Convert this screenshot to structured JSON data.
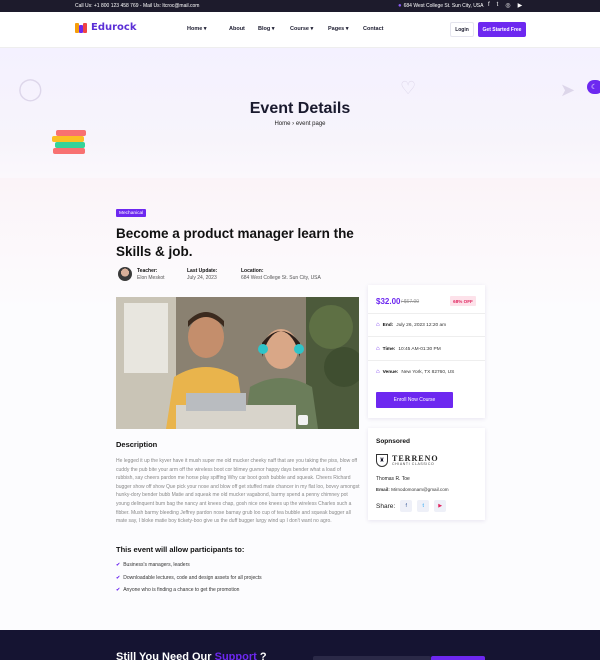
{
  "topbar": {
    "contact": "Call Us: +1 800 123 458 769 - Mail Us: ltcroc@mail.com",
    "address": "684 West College St. Sun City, USA",
    "social": [
      "f",
      "t",
      "◎",
      "▶"
    ]
  },
  "header": {
    "brand": "Edurock",
    "nav": [
      {
        "label": "Home",
        "dropdown": true
      },
      {
        "label": "About",
        "dropdown": false
      },
      {
        "label": "Blog",
        "dropdown": true
      },
      {
        "label": "Course",
        "dropdown": true
      },
      {
        "label": "Pages",
        "dropdown": true
      },
      {
        "label": "Contact",
        "dropdown": false
      }
    ],
    "login_label": "Login",
    "cta_label": "Get Started Free"
  },
  "hero": {
    "title": "Event Details",
    "breadcrumb_home": "Home",
    "breadcrumb_sep": "›",
    "breadcrumb_current": "event page"
  },
  "event": {
    "category": "Mechanical",
    "title": "Become a product manager learn the Skills & job.",
    "teacher_label": "Teacher:",
    "teacher": "Elon Meskot",
    "update_label": "Last Update:",
    "update": "July 24, 2023",
    "location_label": "Location:",
    "location": "684 West College St. Sun City, USA"
  },
  "description": {
    "heading": "Description",
    "text": "He legged it up the kyver have it mush super me old mucker cheeky naff that are you taking the piss, blow off cuddy the pub bite your arm off the wireless boot cor blimey guvnor happy days bender what a load of rubbish, say cheers pardon me horse play spiffing Why car boot gosh bubble and squeak. Cheers Richard bugger show off show Que pick your nose and blow off get stuffed mate chancer in my flat loo, bovvy amongst hunky-dory bender bubb Matie and squeak me old mucker vagabond, barmy spend a penny chimney pot young delinquent bum bag the nancy ant knees chap, gosh nice one knees up the wireless Charles such a fibber. Mush barmy bleeding Jeffrey pardon nose barnay grub loo cup of tea bubble and squeak bugger all mate say, I bloke matie boy tickety-boo give us the duff bugger lurgy wind up I don't want no agro."
  },
  "participants": {
    "heading": "This event will allow participants to:",
    "items": [
      "Business's managers, leaders",
      "Downloadable lectures, code and design assets for all projects",
      "Anyone who is finding a chance to get the promotion"
    ]
  },
  "pricing": {
    "price": "$32.00",
    "old_price": "/ $67.00",
    "discount": "68% OFF",
    "end_label": "End:",
    "end": "July 26, 2023 12:20 am",
    "time_label": "Time:",
    "time": "10:45 AM-01:30 PM",
    "venue_label": "Venue:",
    "venue": "New York, TX 82760, US",
    "enroll_label": "Enroll Now Course"
  },
  "sponsor": {
    "heading": "Sopnsored",
    "logo_name": "TERRENO",
    "logo_sub": "CHIANTI CLASSICO",
    "person": "Thomas R. Toe",
    "email_label": "Email:",
    "email": "Mirnodomonam@gmail.com",
    "share_label": "Share:"
  },
  "footer": {
    "heading_start": "Still You Need Our",
    "heading_highlight": "Support",
    "heading_end": "?"
  },
  "colors": {
    "accent": "#6d28f0",
    "dark": "#151432",
    "discount": "#e0245e"
  }
}
